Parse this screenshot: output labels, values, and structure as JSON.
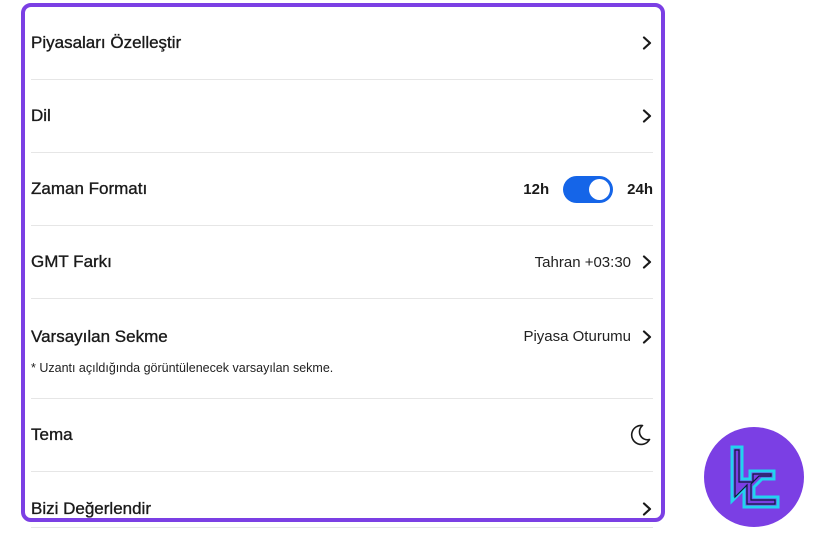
{
  "settings": {
    "customize_markets": {
      "label": "Piyasaları Özelleştir"
    },
    "language": {
      "label": "Dil"
    },
    "time_format": {
      "label": "Zaman Formatı",
      "option_left": "12h",
      "option_right": "24h",
      "selected": "24h"
    },
    "gmt_offset": {
      "label": "GMT Farkı",
      "value": "Tahran +03:30"
    },
    "default_tab": {
      "label": "Varsayılan Sekme",
      "value": "Piyasa Oturumu",
      "note": "* Uzantı açıldığında görüntülenecek varsayılan sekme."
    },
    "theme": {
      "label": "Tema",
      "icon": "moon-icon"
    },
    "rate_us": {
      "label": "Bizi Değerlendir"
    }
  },
  "colors": {
    "accent_border": "#7b3fe4",
    "toggle_on": "#1565e8",
    "logo_bg": "#7b3fe4",
    "logo_fg": "#22d3ee"
  }
}
